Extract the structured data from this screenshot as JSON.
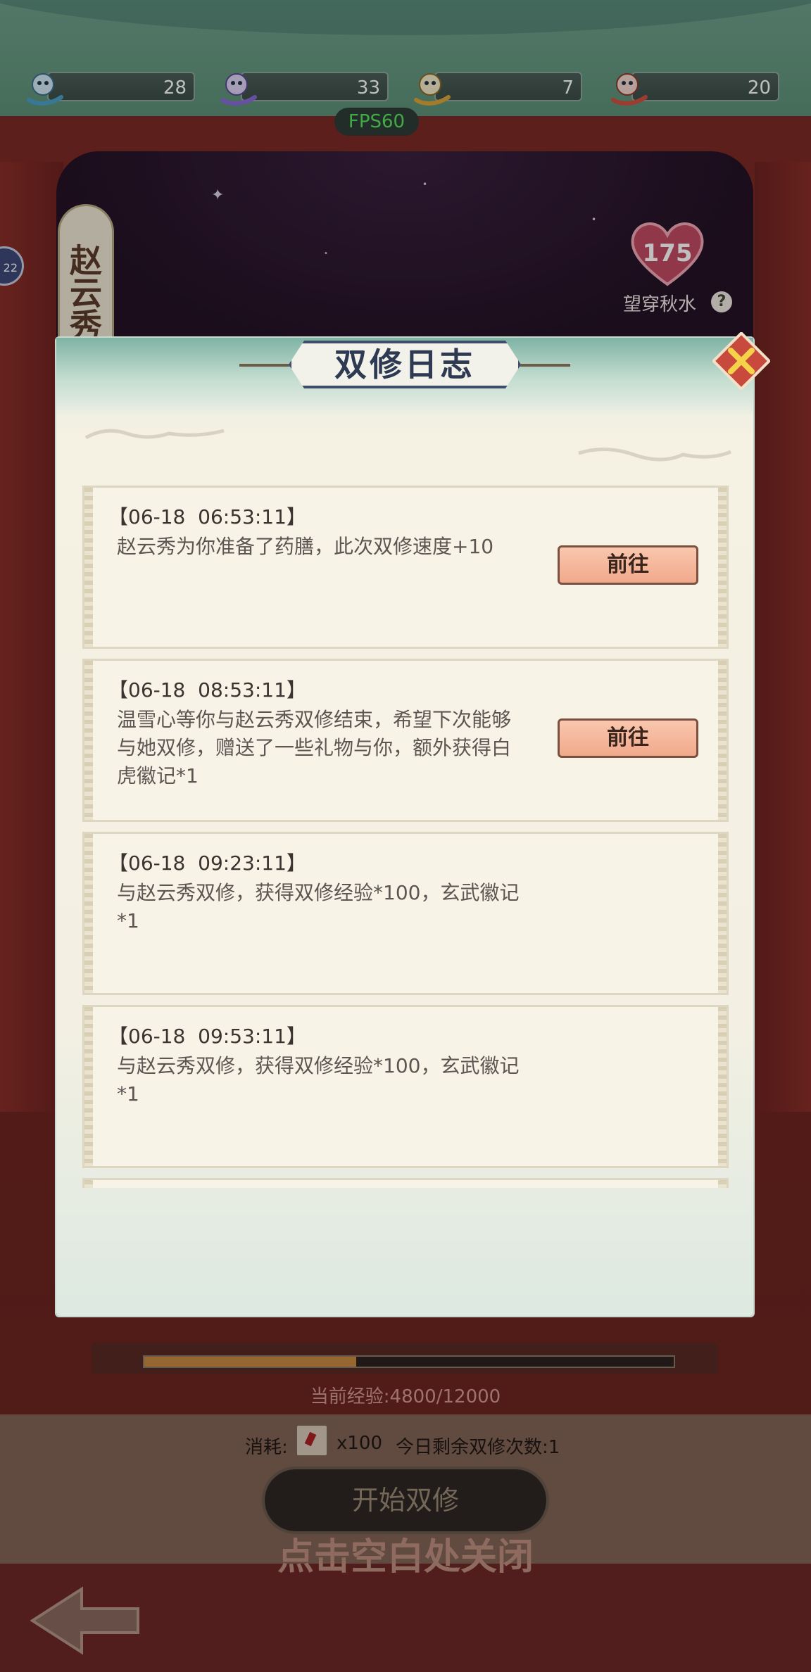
{
  "currencies": [
    {
      "icon": "blue-dragon-icon",
      "value": "28"
    },
    {
      "icon": "purple-dragon-icon",
      "value": "33"
    },
    {
      "icon": "gold-dragon-icon",
      "value": "7"
    },
    {
      "icon": "red-dragon-icon",
      "value": "20"
    }
  ],
  "fps": "FPS60",
  "character": {
    "name": "赵云秀",
    "left_badge": "22",
    "affection": "175",
    "affection_label": "望穿秋水",
    "help": "?"
  },
  "dialog": {
    "title": "双修日志",
    "goto_label": "前往",
    "logs": [
      {
        "time": "【06-18  06:53:11】",
        "text": "赵云秀为你准备了药膳，此次双修速度+10",
        "has_goto": true
      },
      {
        "time": "【06-18  08:53:11】",
        "text": "温雪心等你与赵云秀双修结束，希望下次能够与她双修，赠送了一些礼物与你，额外获得白虎徽记*1",
        "has_goto": true
      },
      {
        "time": "【06-18  09:23:11】",
        "text": "与赵云秀双修，获得双修经验*100，玄武徽记*1",
        "has_goto": false
      },
      {
        "time": "【06-18  09:53:11】",
        "text": "与赵云秀双修，获得双修经验*100，玄武徽记*1",
        "has_goto": false
      }
    ]
  },
  "experience": {
    "label": "当前经验:4800/12000",
    "current": 4800,
    "max": 12000
  },
  "cost": {
    "prefix": "消耗:",
    "amount": "x100",
    "remaining": "今日剩余双修次数:1"
  },
  "start_button": "开始双修",
  "close_hint": "点击空白处关闭",
  "colors": {
    "accent_green": "#59e25d",
    "goto_button": "#f1a98b",
    "title_border": "#3e4e6a"
  }
}
